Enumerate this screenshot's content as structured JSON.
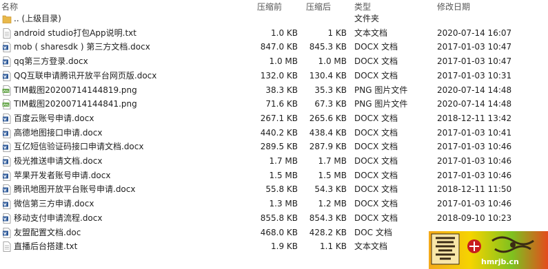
{
  "header": {
    "name": "名称",
    "size_before": "压缩前",
    "size_after": "压缩后",
    "type": "类型",
    "modified": "修改日期"
  },
  "rows": [
    {
      "name": ".. (上级目录)",
      "before": "",
      "after": "",
      "type": "文件夹",
      "date": "",
      "icon": "folder-icon"
    },
    {
      "name": "android studio打包App说明.txt",
      "before": "1.0 KB",
      "after": "1 KB",
      "type": "文本文档",
      "date": "2020-07-14 16:07",
      "icon": "text-file-icon"
    },
    {
      "name": "mob ( sharesdk ) 第三方文档.docx",
      "before": "847.0 KB",
      "after": "845.3 KB",
      "type": "DOCX 文档",
      "date": "2017-01-03 10:47",
      "icon": "word-doc-icon"
    },
    {
      "name": "qq第三方登录.docx",
      "before": "1.0 MB",
      "after": "1.0 MB",
      "type": "DOCX 文档",
      "date": "2017-01-03 10:47",
      "icon": "word-doc-icon"
    },
    {
      "name": "QQ互联申请腾讯开放平台网页版.docx",
      "before": "132.0 KB",
      "after": "130.4 KB",
      "type": "DOCX 文档",
      "date": "2017-01-03 10:31",
      "icon": "word-doc-icon"
    },
    {
      "name": "TIM截图20200714144819.png",
      "before": "38.3 KB",
      "after": "35.3 KB",
      "type": "PNG 图片文件",
      "date": "2020-07-14 14:48",
      "icon": "png-image-icon"
    },
    {
      "name": "TIM截图20200714144841.png",
      "before": "71.6 KB",
      "after": "67.3 KB",
      "type": "PNG 图片文件",
      "date": "2020-07-14 14:48",
      "icon": "png-image-icon"
    },
    {
      "name": "百度云账号申请.docx",
      "before": "267.1 KB",
      "after": "265.6 KB",
      "type": "DOCX 文档",
      "date": "2018-12-11 13:42",
      "icon": "word-doc-icon"
    },
    {
      "name": "高德地图接口申请.docx",
      "before": "440.2 KB",
      "after": "438.4 KB",
      "type": "DOCX 文档",
      "date": "2017-01-03 10:41",
      "icon": "word-doc-icon"
    },
    {
      "name": "互亿短信验证码接口申请文档.docx",
      "before": "289.5 KB",
      "after": "287.9 KB",
      "type": "DOCX 文档",
      "date": "2017-01-03 10:46",
      "icon": "word-doc-icon"
    },
    {
      "name": "极光推送申请文档.docx",
      "before": "1.7 MB",
      "after": "1.7 MB",
      "type": "DOCX 文档",
      "date": "2017-01-03 10:46",
      "icon": "word-doc-icon"
    },
    {
      "name": "苹果开发者账号申请.docx",
      "before": "1.5 MB",
      "after": "1.5 MB",
      "type": "DOCX 文档",
      "date": "2017-01-03 10:46",
      "icon": "word-doc-icon"
    },
    {
      "name": "腾讯地图开放平台账号申请.docx",
      "before": "55.8 KB",
      "after": "54.3 KB",
      "type": "DOCX 文档",
      "date": "2018-12-11 11:50",
      "icon": "word-doc-icon"
    },
    {
      "name": "微信第三方申请.docx",
      "before": "1.3 MB",
      "after": "1.2 MB",
      "type": "DOCX 文档",
      "date": "2017-01-03 10:46",
      "icon": "word-doc-icon"
    },
    {
      "name": "移动支付申请流程.docx",
      "before": "855.8 KB",
      "after": "854.3 KB",
      "type": "DOCX 文档",
      "date": "2018-09-10 10:23",
      "icon": "word-doc-icon"
    },
    {
      "name": "友盟配置文档.doc",
      "before": "468.0 KB",
      "after": "428.2 KB",
      "type": "DOC 文档",
      "date": "",
      "icon": "word-doc-icon"
    },
    {
      "name": "直播后台搭建.txt",
      "before": "1.9 KB",
      "after": "1.1 KB",
      "type": "文本文档",
      "date": "",
      "icon": "text-file-icon"
    }
  ],
  "watermark": {
    "text": "hmrjb.cn"
  },
  "colors": {
    "header_text": "#555555",
    "row_text": "#1e1e1e",
    "folder": "#e8b84a",
    "word_blue": "#2b5797",
    "png_green": "#6aa84f"
  }
}
